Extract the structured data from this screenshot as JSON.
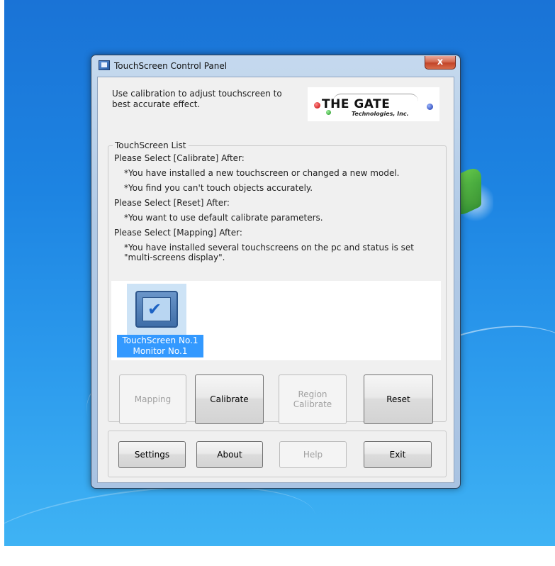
{
  "window": {
    "title": "TouchScreen Control Panel",
    "close_label": "x"
  },
  "intro": "Use calibration to adjust touchscreen to best accurate effect.",
  "logo": {
    "main": "THE GATE",
    "sub": "Technologies, Inc."
  },
  "list_group": {
    "legend": "TouchScreen List",
    "instructions": [
      "Please Select [Calibrate] After:",
      "*You have installed a new touchscreen or changed a new model.",
      "*You find you can't touch objects accurately.",
      "Please Select [Reset] After:",
      "*You want to use default calibrate parameters.",
      "Please Select [Mapping] After:",
      "*You have installed several touchscreens on the pc and status is set",
      "\"multi-screens display\"."
    ],
    "screen_item": {
      "line1": "TouchScreen No.1",
      "line2": "Monitor No.1"
    }
  },
  "action_buttons": {
    "mapping": "Mapping",
    "calibrate": "Calibrate",
    "region_line1": "Region",
    "region_line2": "Calibrate",
    "reset": "Reset"
  },
  "footer_buttons": {
    "settings": "Settings",
    "about": "About",
    "help": "Help",
    "exit": "Exit"
  },
  "colors": {
    "selection": "#3399ff",
    "desktop": "#1d84e2",
    "close_button": "#c2452a"
  }
}
